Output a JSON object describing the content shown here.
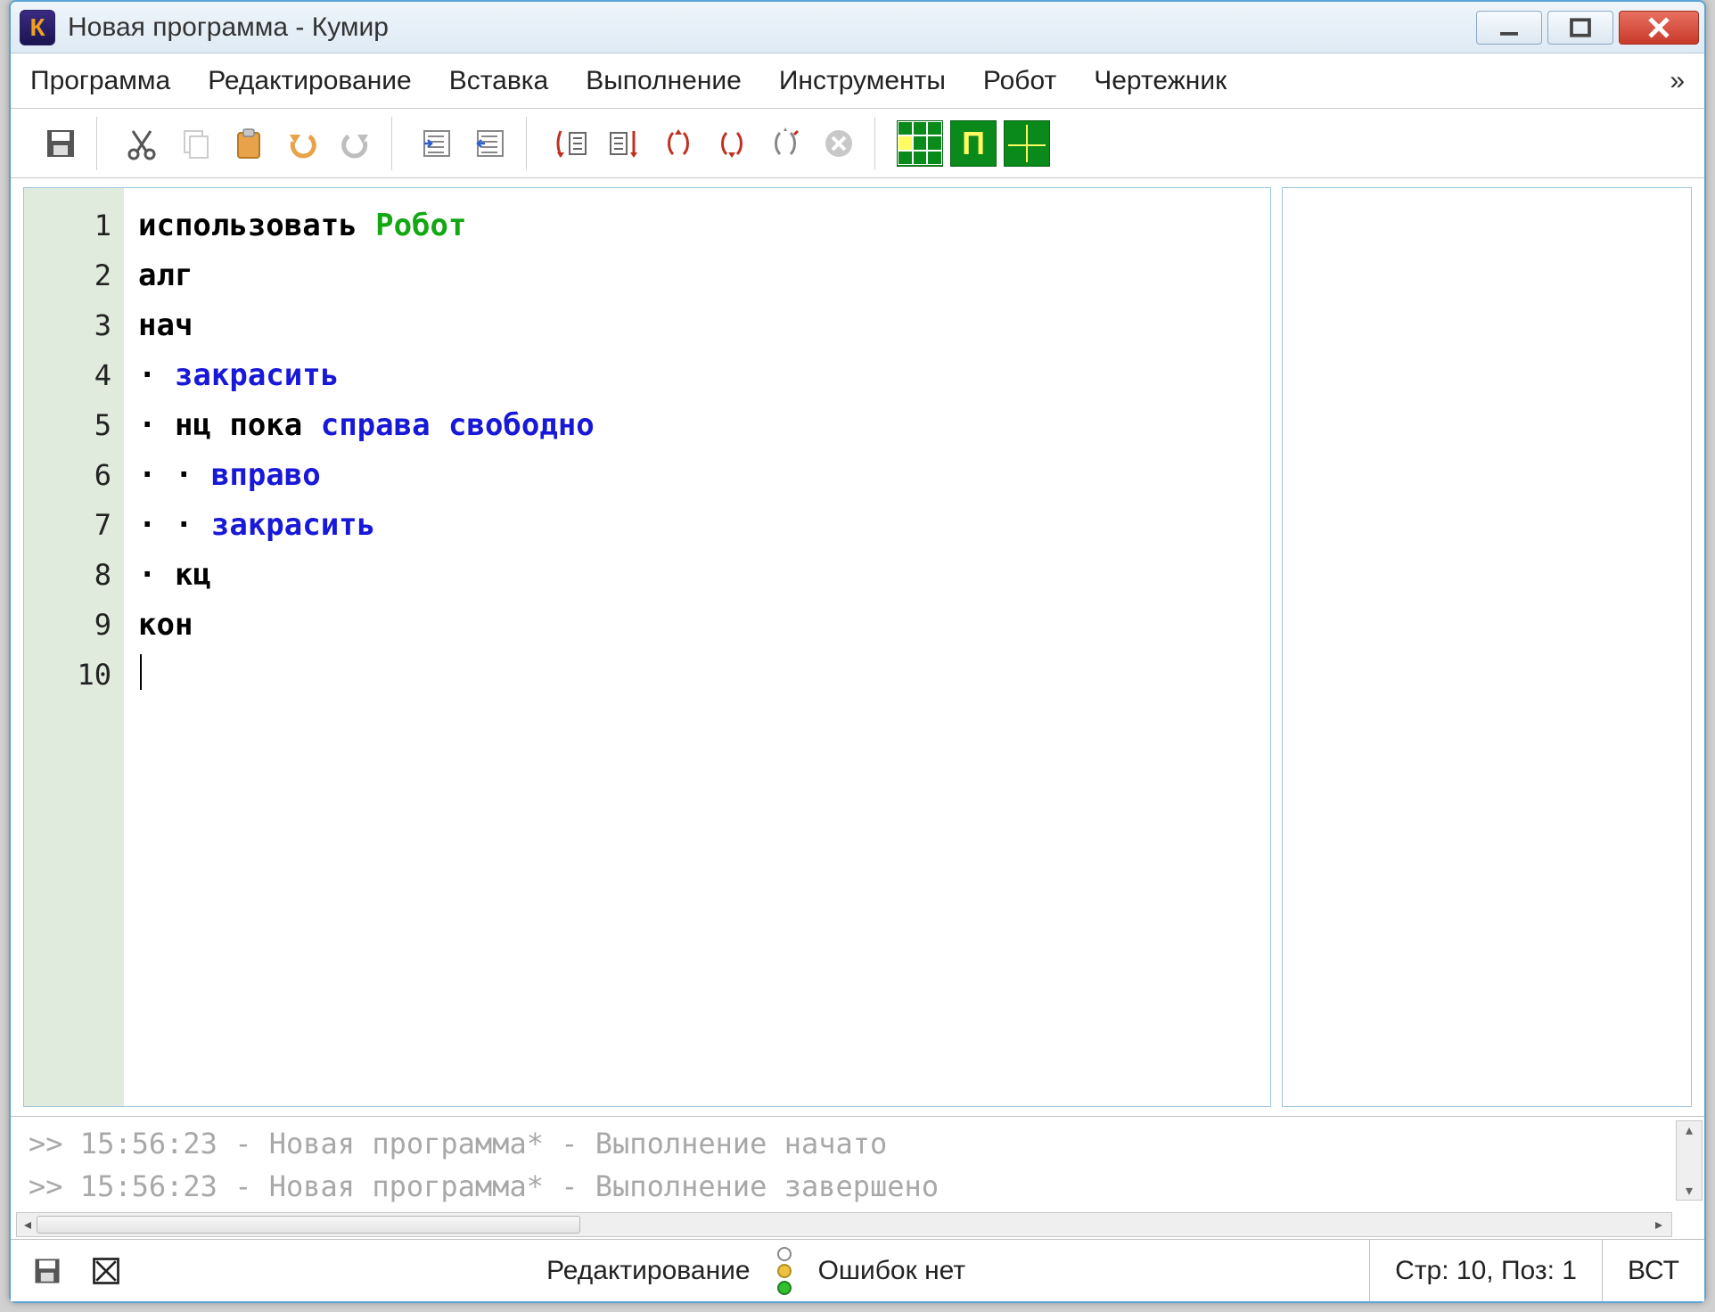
{
  "title": "Новая программа - Кумир",
  "app_icon_letter": "К",
  "menus": {
    "program": "Программа",
    "edit": "Редактирование",
    "insert": "Вставка",
    "run": "Выполнение",
    "tools": "Инструменты",
    "robot": "Робот",
    "drawer": "Чертежник",
    "overflow": "»"
  },
  "code_lines": [
    {
      "n": "1",
      "segments": [
        {
          "t": "использовать ",
          "c": "kw-black"
        },
        {
          "t": "Робот",
          "c": "kw-green"
        }
      ]
    },
    {
      "n": "2",
      "segments": [
        {
          "t": "алг",
          "c": "kw-black"
        }
      ]
    },
    {
      "n": "3",
      "segments": [
        {
          "t": "нач",
          "c": "kw-black"
        }
      ]
    },
    {
      "n": "4",
      "segments": [
        {
          "t": "· ",
          "c": "dot"
        },
        {
          "t": "закрасить",
          "c": "kw-blue"
        }
      ]
    },
    {
      "n": "5",
      "segments": [
        {
          "t": "· ",
          "c": "dot"
        },
        {
          "t": "нц пока ",
          "c": "kw-black"
        },
        {
          "t": "справа свободно",
          "c": "kw-blue"
        }
      ]
    },
    {
      "n": "6",
      "segments": [
        {
          "t": "· · ",
          "c": "dot"
        },
        {
          "t": "вправо",
          "c": "kw-blue"
        }
      ]
    },
    {
      "n": "7",
      "segments": [
        {
          "t": "· · ",
          "c": "dot"
        },
        {
          "t": "закрасить",
          "c": "kw-blue"
        }
      ]
    },
    {
      "n": "8",
      "segments": [
        {
          "t": "· ",
          "c": "dot"
        },
        {
          "t": "кц",
          "c": "kw-black"
        }
      ]
    },
    {
      "n": "9",
      "segments": [
        {
          "t": "кон",
          "c": "kw-black"
        }
      ]
    },
    {
      "n": "10",
      "segments": []
    }
  ],
  "log": {
    "line1": ">> 15:56:23 - Новая программа* - Выполнение начато",
    "line2": ">> 15:56:23 - Новая программа* - Выполнение завершено"
  },
  "status": {
    "mode": "Редактирование",
    "errors": "Ошибок нет",
    "position": "Стр: 10, Поз: 1",
    "insert": "ВСТ"
  }
}
